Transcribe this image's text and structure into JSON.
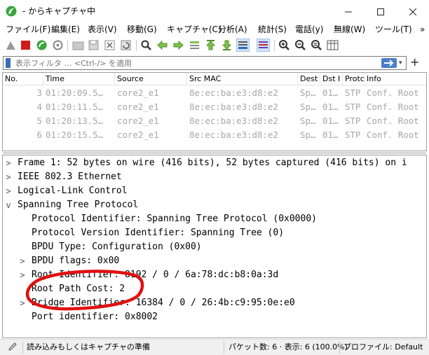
{
  "window": {
    "title": "- からキャプチャ中",
    "min_icon": "minimize-icon",
    "max_icon": "maximize-icon",
    "close_icon": "close-icon"
  },
  "menu": [
    "ファイル(F)",
    "編集(E)",
    "表示(V)",
    "移動(G)",
    "キャプチャ(C)",
    "分析(A)",
    "統計(S)",
    "電話(y)",
    "無線(W)",
    "ツール(T)"
  ],
  "menu_overflow": "»",
  "toolbar": {
    "icons": [
      "shark-fin-icon",
      "stop-capture-icon",
      "restart-capture-icon",
      "capture-options-icon",
      "open-file-icon",
      "save-file-icon",
      "close-file-icon",
      "reload-file-icon",
      "find-packet-icon",
      "go-back-icon",
      "go-forward-icon",
      "go-to-packet-icon",
      "go-to-first-icon",
      "go-to-last-icon",
      "auto-scroll-icon",
      "colorize-icon",
      "zoom-in-icon",
      "zoom-out-icon",
      "normal-size-icon",
      "resize-columns-icon"
    ]
  },
  "filter": {
    "placeholder": "表示フィルタ … <Ctrl-/> を適用",
    "dropdown": "▾",
    "add": "+"
  },
  "packet_list": {
    "columns": [
      "No.",
      "Time",
      "Source",
      "Src MAC",
      "Dest",
      "Dst I",
      "Protc",
      "Info"
    ],
    "rows": [
      [
        "3",
        "01:20:09.5…",
        "core2_e1",
        "8e:ec:ba:e3:d8:e2",
        "Sp…",
        "01…",
        "STP",
        "Conf. Root"
      ],
      [
        "4",
        "01:20:11.5…",
        "core2_e1",
        "8e:ec:ba:e3:d8:e2",
        "Sp…",
        "01…",
        "STP",
        "Conf. Root"
      ],
      [
        "5",
        "01:20:13.5…",
        "core2_e1",
        "8e:ec:ba:e3:d8:e2",
        "Sp…",
        "01…",
        "STP",
        "Conf. Root"
      ],
      [
        "6",
        "01:20:15.5…",
        "core2_e1",
        "8e:ec:ba:e3:d8:e2",
        "Sp…",
        "01…",
        "STP",
        "Conf. Root"
      ]
    ]
  },
  "details": [
    {
      "exp": ">",
      "text": "Frame 1: 52 bytes on wire (416 bits), 52 bytes captured (416 bits) on i"
    },
    {
      "exp": ">",
      "text": "IEEE 802.3 Ethernet"
    },
    {
      "exp": ">",
      "text": "Logical-Link Control"
    },
    {
      "exp": "v",
      "text": "Spanning Tree Protocol"
    },
    {
      "exp": "",
      "text": "Protocol Identifier: Spanning Tree Protocol (0x0000)"
    },
    {
      "exp": "",
      "text": "Protocol Version Identifier: Spanning Tree (0)"
    },
    {
      "exp": "",
      "text": "BPDU Type: Configuration (0x00)"
    },
    {
      "exp": ">",
      "text": "BPDU flags: 0x00"
    },
    {
      "exp": ">",
      "text": "Root Identifier: 8192 / 0 / 6a:78:dc:b8:0a:3d"
    },
    {
      "exp": "",
      "text": "Root Path Cost: 2"
    },
    {
      "exp": ">",
      "text": "Bridge Identifier: 16384 / 0 / 26:4b:c9:95:0e:e0"
    },
    {
      "exp": "",
      "text": "Port identifier: 0x8002"
    }
  ],
  "annotation": {
    "color": "#e01010"
  },
  "status": {
    "ready": "読み込みもしくはキャプチャの準備",
    "packets": "パケット数: 6 · 表示: 6 (100.0%)",
    "profile": "プロファイル: Default"
  },
  "colors": {
    "app_green": "#3aa63a",
    "accent_blue": "#4a7ec8",
    "dim_text": "#a7a7a7"
  }
}
